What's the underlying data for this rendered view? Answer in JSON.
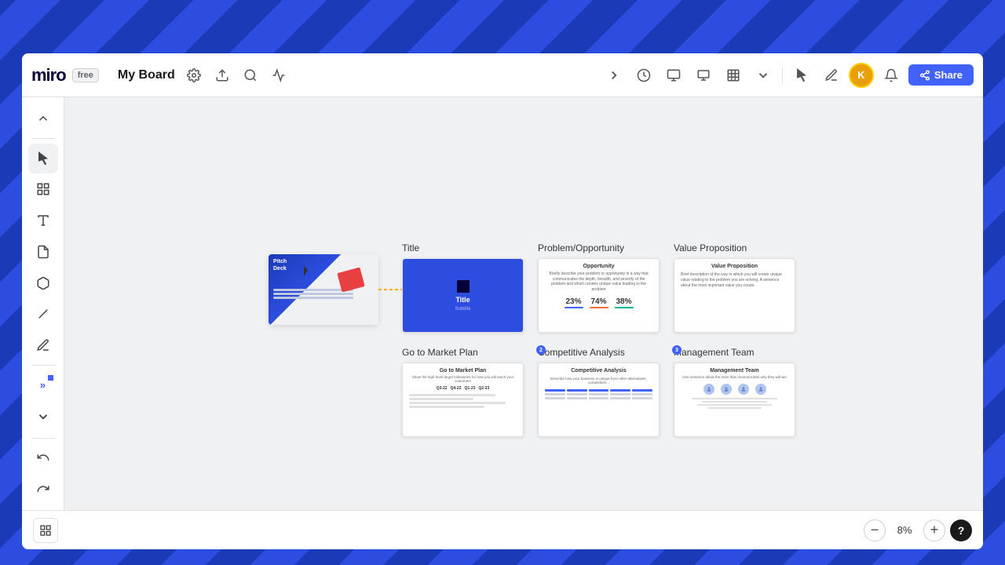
{
  "app": {
    "logo": "miro",
    "plan": "free",
    "board_name": "My Board"
  },
  "header": {
    "settings_label": "Settings",
    "upload_label": "Upload",
    "search_label": "Search",
    "timer_label": "Timer",
    "share_label": "Share"
  },
  "toolbar": {
    "tools": [
      {
        "name": "collapse-icon",
        "symbol": "↑"
      },
      {
        "name": "select-tool",
        "symbol": "▲"
      },
      {
        "name": "frames-tool",
        "symbol": "□"
      },
      {
        "name": "text-tool",
        "symbol": "T"
      },
      {
        "name": "sticky-note-tool",
        "symbol": "◱"
      },
      {
        "name": "shapes-tool",
        "symbol": "⬡"
      },
      {
        "name": "line-tool",
        "symbol": "╱"
      },
      {
        "name": "pen-tool",
        "symbol": "✏"
      },
      {
        "name": "more-tools",
        "symbol": "»"
      },
      {
        "name": "expand-tools",
        "symbol": "⌄"
      }
    ]
  },
  "slides": {
    "row1": [
      {
        "id": "title",
        "label": "Title",
        "type": "title"
      },
      {
        "id": "problem",
        "label": "Problem/Opportunity",
        "type": "problem"
      },
      {
        "id": "value",
        "label": "Value Proposition",
        "type": "value"
      }
    ],
    "row2": [
      {
        "id": "gtm",
        "label": "Go to Market Plan",
        "type": "gtm"
      },
      {
        "id": "competitive",
        "label": "Competitive Analysis",
        "type": "competitive",
        "num": "2"
      },
      {
        "id": "management",
        "label": "Management Team",
        "type": "management",
        "num": "3"
      }
    ]
  },
  "problem_stats": [
    "23%",
    "74%",
    "38%"
  ],
  "gtm_quarters": [
    "Q3-22",
    "Q4-22",
    "Q1-23",
    "Q2-23"
  ],
  "zoom": {
    "level": "8%",
    "minus_label": "−",
    "plus_label": "+"
  }
}
